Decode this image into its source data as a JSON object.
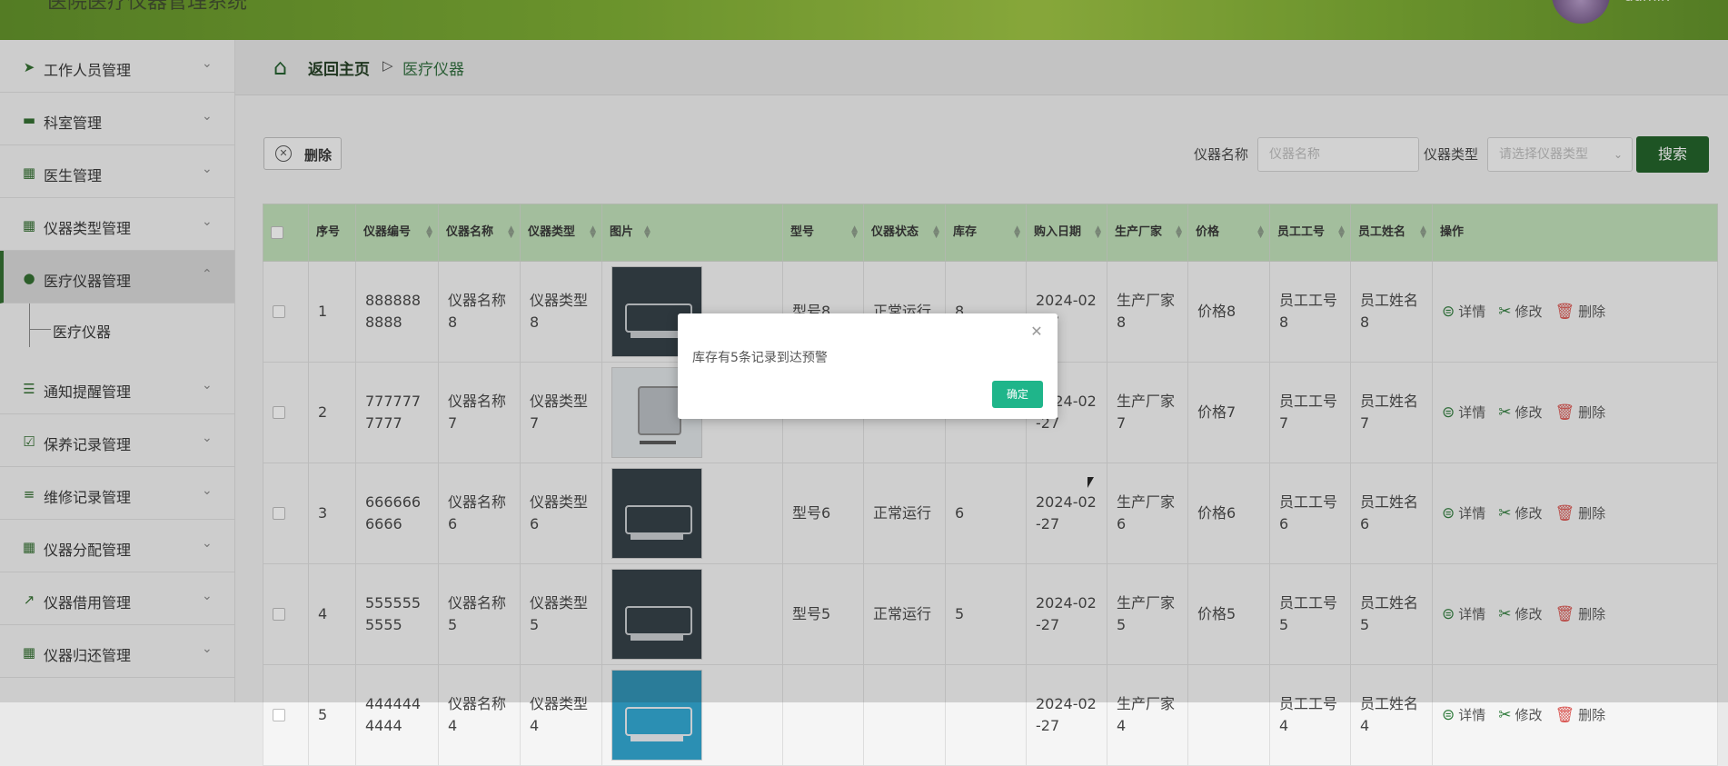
{
  "header": {
    "app_title": "医院医疗仪器管理系统",
    "user_name": "admin"
  },
  "sidebar": {
    "items": [
      {
        "label": "工作人员管理",
        "icon": "paper-plane-icon"
      },
      {
        "label": "科室管理",
        "icon": "ticket-icon"
      },
      {
        "label": "医生管理",
        "icon": "grid-icon"
      },
      {
        "label": "仪器类型管理",
        "icon": "grid-icon"
      },
      {
        "label": "医疗仪器管理",
        "icon": "bulb-icon"
      },
      {
        "label": "通知提醒管理",
        "icon": "sliders-icon"
      },
      {
        "label": "保养记录管理",
        "icon": "checklist-icon"
      },
      {
        "label": "维修记录管理",
        "icon": "list-icon"
      },
      {
        "label": "仪器分配管理",
        "icon": "grid-icon"
      },
      {
        "label": "仪器借用管理",
        "icon": "chart-icon"
      },
      {
        "label": "仪器归还管理",
        "icon": "grid-icon"
      }
    ],
    "sub_item": "医疗仪器"
  },
  "breadcrumb": {
    "back": "返回主页",
    "separator": "▷",
    "current": "医疗仪器"
  },
  "toolbar": {
    "delete_label": "删除",
    "name_label": "仪器名称",
    "name_placeholder": "仪器名称",
    "type_label": "仪器类型",
    "type_placeholder": "请选择仪器类型",
    "search_label": "搜索"
  },
  "table": {
    "headers": [
      "序号",
      "仪器编号",
      "仪器名称",
      "仪器类型",
      "图片",
      "型号",
      "仪器状态",
      "库存",
      "购入日期",
      "生产厂家",
      "价格",
      "员工工号",
      "员工姓名",
      "操作"
    ],
    "rows": [
      {
        "no": "1",
        "code": "8888888888",
        "name": "仪器名称8",
        "type": "仪器类型8",
        "model": "型号8",
        "status": "正常运行",
        "stock": "8",
        "date": "2024-02-27",
        "maker": "生产厂家8",
        "price": "价格8",
        "emp_no": "员工工号8",
        "emp_name": "员工姓名8"
      },
      {
        "no": "2",
        "code": "7777777777",
        "name": "仪器名称7",
        "type": "仪器类型7",
        "model": "",
        "status": "",
        "stock": "",
        "date": "2024-02-27",
        "maker": "生产厂家7",
        "price": "价格7",
        "emp_no": "员工工号7",
        "emp_name": "员工姓名7"
      },
      {
        "no": "3",
        "code": "6666666666",
        "name": "仪器名称6",
        "type": "仪器类型6",
        "model": "型号6",
        "status": "正常运行",
        "stock": "6",
        "date": "2024-02-27",
        "maker": "生产厂家6",
        "price": "价格6",
        "emp_no": "员工工号6",
        "emp_name": "员工姓名6"
      },
      {
        "no": "4",
        "code": "5555555555",
        "name": "仪器名称5",
        "type": "仪器类型5",
        "model": "型号5",
        "status": "正常运行",
        "stock": "5",
        "date": "2024-02-27",
        "maker": "生产厂家5",
        "price": "价格5",
        "emp_no": "员工工号5",
        "emp_name": "员工姓名5"
      },
      {
        "no": "5",
        "code": "4444444444",
        "name": "仪器名称4",
        "type": "仪器类型4",
        "model": "",
        "status": "",
        "stock": "",
        "date": "2024-02-27",
        "maker": "生产厂家4",
        "price": "",
        "emp_no": "员工工号4",
        "emp_name": "员工姓名4"
      }
    ],
    "ops": {
      "detail": "详情",
      "edit": "修改",
      "delete": "删除"
    }
  },
  "modal": {
    "message": "库存有5条记录到达预警",
    "ok_label": "确定",
    "close_icon": "close-icon"
  }
}
